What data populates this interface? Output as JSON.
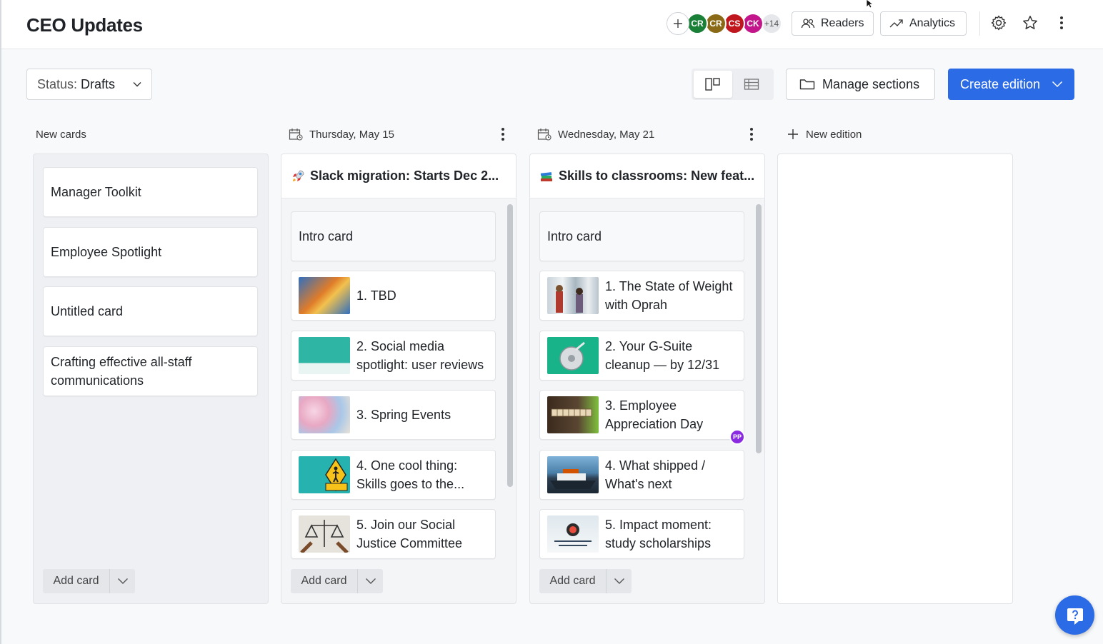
{
  "header": {
    "title": "CEO Updates",
    "add_member": "+",
    "avatars": [
      {
        "initials": "CR",
        "color": "#1a7f37"
      },
      {
        "initials": "CR",
        "color": "#8a6a16"
      },
      {
        "initials": "CS",
        "color": "#c0171e"
      },
      {
        "initials": "CK",
        "color": "#c2168a"
      }
    ],
    "more_count": "+14",
    "readers_label": "Readers",
    "analytics_label": "Analytics",
    "icons": [
      "plus-icon",
      "users-icon",
      "trend-icon",
      "gear-icon",
      "star-icon",
      "kebab-icon"
    ]
  },
  "toolbar": {
    "status_prefix": "Status:",
    "status_value": "Drafts",
    "manage_label": "Manage sections",
    "create_label": "Create edition"
  },
  "columns": {
    "new_cards": {
      "header": "New cards",
      "cards": [
        {
          "title": "Manager Toolkit"
        },
        {
          "title": "Employee Spotlight"
        },
        {
          "title": "Untitled card"
        },
        {
          "title": "Crafting effective all-staff communications"
        }
      ],
      "add_label": "Add card"
    },
    "edition1": {
      "date": "Thursday, May 15",
      "title": "Slack migration: Starts Dec 2...",
      "emoji": "rocket",
      "cards": [
        {
          "title": "Intro card"
        },
        {
          "title": "1. TBD",
          "thumb": "#3a7bc8"
        },
        {
          "title": "2. Social media spotlight: user reviews",
          "thumb": "#2fb5a3"
        },
        {
          "title": "3. Spring Events",
          "thumb": "#e8b4c8"
        },
        {
          "title": "4. One cool thing: Skills goes to the...",
          "thumb": "#26b3b0"
        },
        {
          "title": "5. Join our Social Justice Committee",
          "thumb": "#d9d6d0"
        }
      ],
      "add_label": "Add card"
    },
    "edition2": {
      "date": "Wednesday, May 21",
      "title": "Skills to classrooms: New feat...",
      "emoji": "books",
      "cards": [
        {
          "title": "Intro card"
        },
        {
          "title": "1. The State of Weight with Oprah",
          "thumb": "#b8c4cc"
        },
        {
          "title": "2. Your G-Suite cleanup — by 12/31",
          "thumb": "#19b38a"
        },
        {
          "title": "3. Employee Appreciation Day",
          "thumb": "#5a4632",
          "badge": "PP"
        },
        {
          "title": "4. What shipped / What's next",
          "thumb": "#4a7fa8"
        },
        {
          "title": "5. Impact moment: study scholarships",
          "thumb": "#dfe8ee"
        }
      ],
      "add_label": "Add card"
    },
    "new_edition_label": "New edition"
  },
  "colors": {
    "accent": "#2b6be6",
    "badge": "#8a2be2"
  }
}
